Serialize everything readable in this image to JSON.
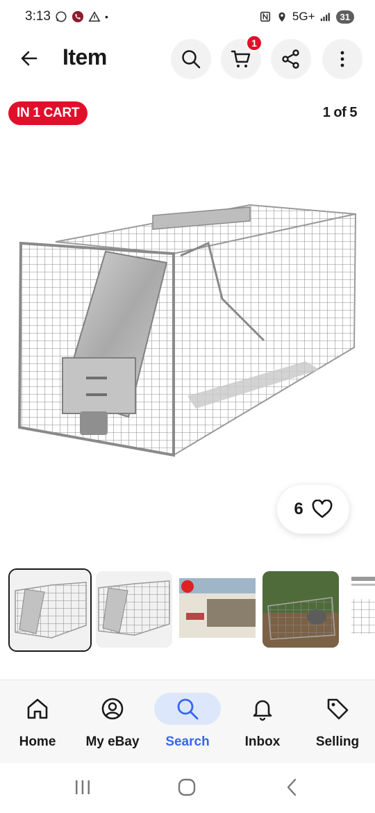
{
  "status_bar": {
    "time": "3:13",
    "network": "5G+",
    "battery": "31",
    "icons_left": [
      "whatsapp-icon",
      "call-icon",
      "alert-icon"
    ],
    "icons_right": [
      "nfc-icon",
      "location-icon",
      "signal-icon",
      "battery-icon"
    ]
  },
  "header": {
    "title": "Item",
    "cart_count": "1",
    "icons": [
      "back-arrow-icon",
      "search-icon",
      "cart-icon",
      "share-icon",
      "more-vertical-icon"
    ]
  },
  "listing": {
    "cart_status": "IN 1 CART",
    "image_counter": "1 of 5",
    "watch_count": "6",
    "thumbnails": [
      {
        "description": "cage-trap-front",
        "selected": true
      },
      {
        "description": "cage-trap-front",
        "selected": false
      },
      {
        "description": "product-box",
        "selected": false
      },
      {
        "description": "raccoon-in-trap",
        "selected": false
      },
      {
        "description": "instructions-sheet",
        "selected": false
      }
    ]
  },
  "bottom_nav": {
    "items": [
      {
        "label": "Home",
        "icon": "home-icon",
        "active": false
      },
      {
        "label": "My eBay",
        "icon": "user-circle-icon",
        "active": false
      },
      {
        "label": "Search",
        "icon": "search-icon",
        "active": true
      },
      {
        "label": "Inbox",
        "icon": "bell-icon",
        "active": false
      },
      {
        "label": "Selling",
        "icon": "tag-icon",
        "active": false
      }
    ]
  },
  "colors": {
    "accent": "#3665f3",
    "cart_badge": "#e0102b",
    "active_nav_bg": "#dde7fb"
  }
}
